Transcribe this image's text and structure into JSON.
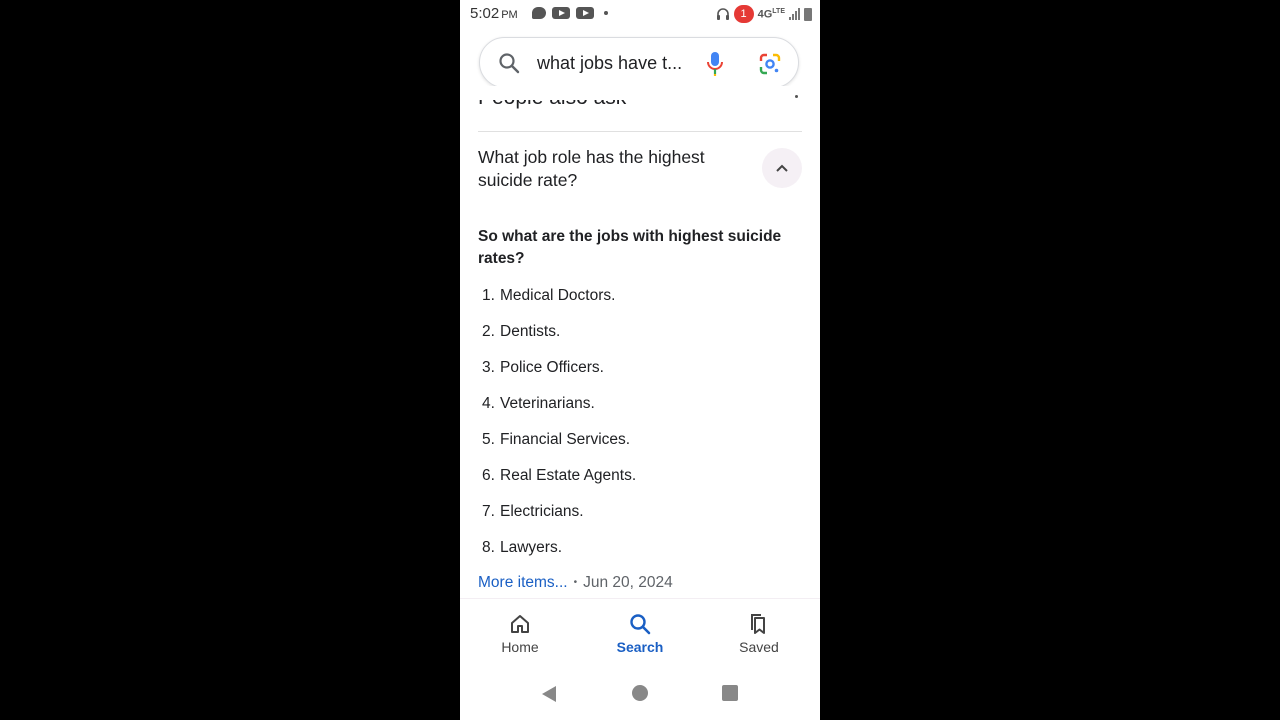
{
  "status_bar": {
    "time": "5:02",
    "ampm": "PM",
    "notification_count": "1",
    "network": "4G",
    "network_sup": "LTE"
  },
  "search": {
    "query": "what jobs have t..."
  },
  "people_also_ask": {
    "heading": "People also ask",
    "question": "What job role has the highest suicide rate?",
    "answer_title": "So what are the jobs with highest suicide rates?",
    "items": [
      {
        "num": "1.",
        "text": "Medical Doctors."
      },
      {
        "num": "2.",
        "text": "Dentists."
      },
      {
        "num": "3.",
        "text": "Police Officers."
      },
      {
        "num": "4.",
        "text": "Veterinarians."
      },
      {
        "num": "5.",
        "text": "Financial Services."
      },
      {
        "num": "6.",
        "text": "Real Estate Agents."
      },
      {
        "num": "7.",
        "text": "Electricians."
      },
      {
        "num": "8.",
        "text": "Lawyers."
      }
    ],
    "more_items": "More items...",
    "separator": "•",
    "date": "Jun 20, 2024"
  },
  "bottom_nav": {
    "home": "Home",
    "search": "Search",
    "saved": "Saved"
  },
  "colors": {
    "accent": "#1a5fc4",
    "badge": "#e53935"
  }
}
